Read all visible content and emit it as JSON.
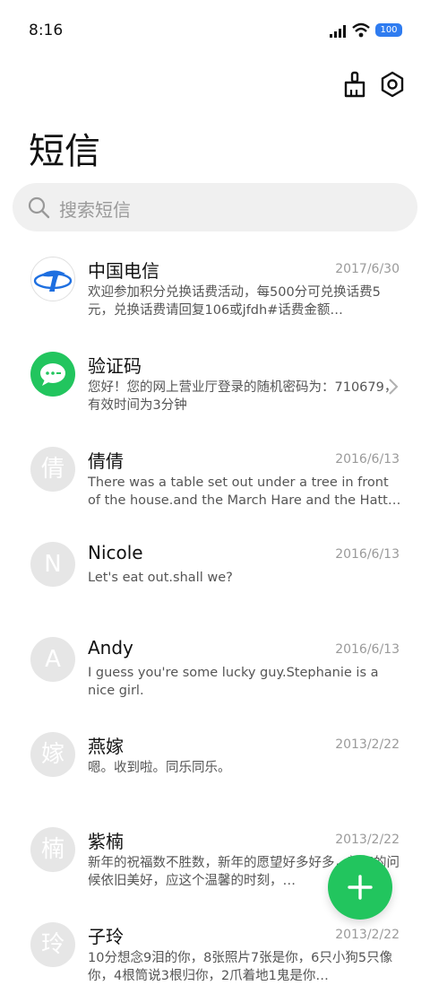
{
  "status": {
    "time": "8:16",
    "battery": "100"
  },
  "header": {
    "title": "短信"
  },
  "search": {
    "placeholder": "搜索短信"
  },
  "colors": {
    "accent": "#22c55e",
    "telecom_blue": "#1e6fe0",
    "avatar_gray": "#e6e6e6"
  },
  "messages": [
    {
      "avatar_text": "",
      "avatar_icon": "china-telecom-logo-icon",
      "name": "中国电信",
      "date": "2017/6/30",
      "preview": "欢迎参加积分兑换话费活动，每500分可兑换话费5元，兑换话费请回复106或jfdh#话费金额…"
    },
    {
      "avatar_text": "",
      "avatar_icon": "sms-bubble-icon",
      "name": "验证码",
      "date": "",
      "preview": "您好！您的网上营业厅登录的随机密码为：710679，有效时间为3分钟"
    },
    {
      "avatar_text": "倩",
      "name": "倩倩",
      "date": "2016/6/13",
      "preview": "There was a table set out under a tree in front of the house.and the March Hare and the Hatt…"
    },
    {
      "avatar_text": "N",
      "name": "Nicole",
      "date": "2016/6/13",
      "preview": "Let's eat out.shall we?"
    },
    {
      "avatar_text": "A",
      "name": "Andy",
      "date": "2016/6/13",
      "preview": "I guess you're some lucky guy.Stephanie is a nice girl."
    },
    {
      "avatar_text": "嫁",
      "name": "燕嫁",
      "date": "2013/2/22",
      "preview": "嗯。收到啦。同乐同乐。"
    },
    {
      "avatar_text": "楠",
      "name": "紫楠",
      "date": "2013/2/22",
      "preview": "新年的祝福数不胜数，新年的愿望好多好多，新年的问候依旧美好，应这个温馨的时刻，…"
    },
    {
      "avatar_text": "玲",
      "name": "子玲",
      "date": "2013/2/22",
      "preview": "10分想念9泪的你，8张照片7张是你，6只小狗5只像你，4根筒说3根归你，2爪着地1鬼是你…"
    }
  ]
}
